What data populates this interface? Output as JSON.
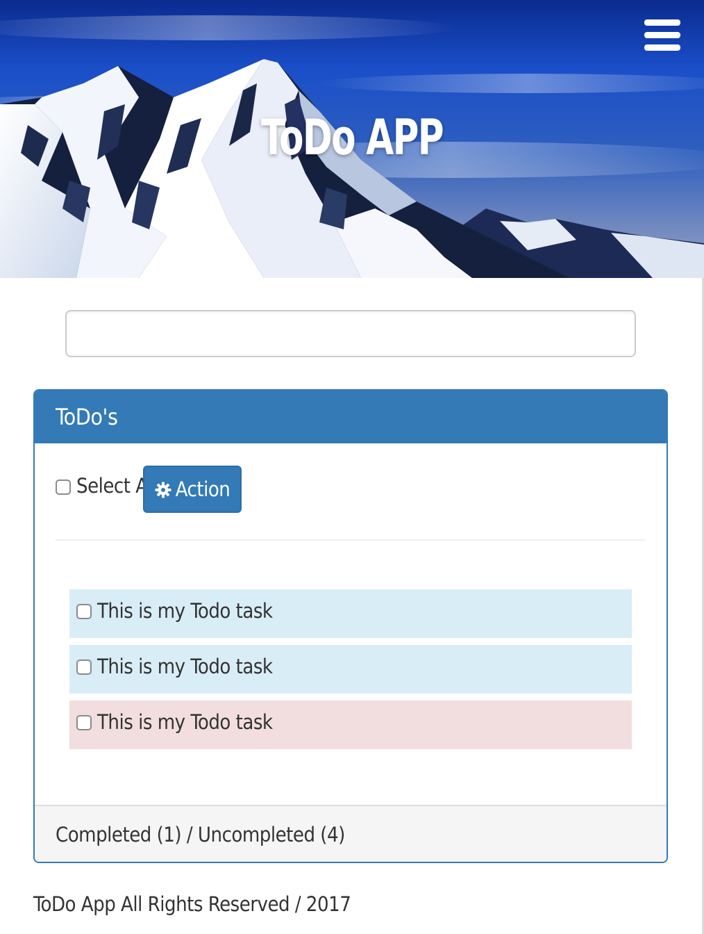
{
  "header": {
    "title": "ToDo APP",
    "menu_icon": "hamburger-icon",
    "hero_image": "snowy-mountain-peak"
  },
  "search": {
    "value": "",
    "placeholder": ""
  },
  "panel": {
    "heading": "ToDo's",
    "select_all_label": "Select All",
    "action_label": "Action",
    "action_icon": "gear-icon",
    "todos": [
      {
        "text": "This is my Todo task",
        "checked": false,
        "color": "#d9edf7"
      },
      {
        "text": "This is my Todo task",
        "checked": false,
        "color": "#d9edf7"
      },
      {
        "text": "This is my Todo task",
        "checked": false,
        "color": "#f2dede"
      }
    ],
    "status": "Completed (1) / Uncompleted (4)"
  },
  "footer": {
    "text": "ToDo App All Rights Reserved / 2017"
  },
  "colors": {
    "primary": "#337ab7",
    "info_row": "#d9edf7",
    "danger_row": "#f2dede",
    "footer_bg": "#f5f5f5"
  }
}
